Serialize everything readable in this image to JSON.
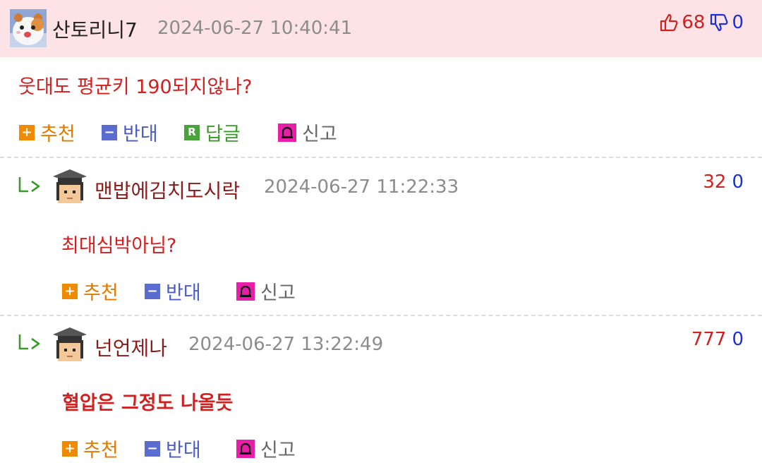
{
  "comments": [
    {
      "nickname": "산토리니7",
      "date": "2024-06-27 10:40:41",
      "body": "웃대도 평균키 190되지않나?",
      "up": "68",
      "down": "0",
      "actions": {
        "recommend": "추천",
        "oppose": "반대",
        "reply": "답글",
        "report": "신고"
      },
      "reply_icon_letter": "R",
      "highlight_color": "#fde3e6"
    },
    {
      "nickname": "맨밥에김치도시락",
      "date": "2024-06-27 11:22:33",
      "body": "최대심박아님?",
      "up": "32",
      "down": "0",
      "actions": {
        "recommend": "추천",
        "oppose": "반대",
        "report": "신고"
      }
    },
    {
      "nickname": "넌언제나",
      "date": "2024-06-27 13:22:49",
      "body": "혈압은 그정도 나올듯",
      "up": "777",
      "down": "0",
      "actions": {
        "recommend": "추천",
        "oppose": "반대",
        "report": "신고"
      }
    }
  ],
  "colors": {
    "up": "#d02020",
    "down": "#1c2fd4",
    "recommend": "#f08a00",
    "oppose": "#5a6ccf",
    "reply": "#4aa23c",
    "report": "#e81ea8"
  },
  "icons": {
    "thumbs_up": "thumbs-up-icon",
    "thumbs_down": "thumbs-down-icon",
    "reply_arrow": "reply-arrow-icon",
    "hamster_avatar": "hamster-avatar",
    "graduate_avatar": "graduate-avatar"
  }
}
